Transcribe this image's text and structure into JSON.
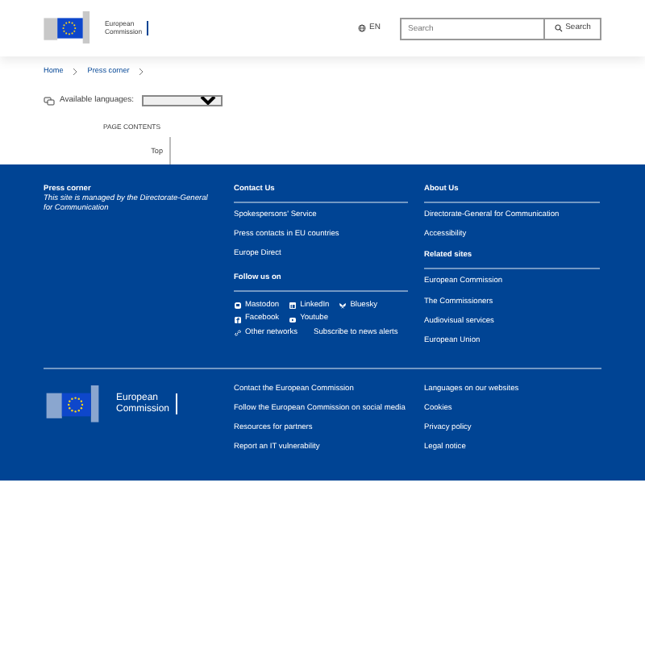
{
  "header": {
    "logo_lines": [
      "European",
      "Commission"
    ],
    "language": "EN",
    "search": {
      "placeholder": "Search"
    },
    "search_button": "Search"
  },
  "breadcrumb": [
    "Home",
    "Press corner"
  ],
  "languages": {
    "label": "Available languages:"
  },
  "page_contents": {
    "title": "PAGE CONTENTS",
    "items": [
      "Top"
    ]
  },
  "footer": {
    "site": {
      "title": "Press corner",
      "description": "This site is managed by the Directorate-General for Communication"
    },
    "contact": {
      "title": "Contact Us",
      "links": [
        "Spokespersons' Service",
        "Press contacts in EU countries",
        "Europe Direct"
      ]
    },
    "follow": {
      "title": "Follow us on",
      "rows": [
        [
          {
            "label": "Mastodon",
            "kind": "mastodon"
          },
          {
            "label": "LinkedIn",
            "kind": "linkedin"
          },
          {
            "label": "Bluesky",
            "kind": "bluesky"
          }
        ],
        [
          {
            "label": "Facebook",
            "kind": "facebook"
          },
          {
            "label": "Youtube",
            "kind": "youtube"
          }
        ],
        [
          {
            "label": "Other networks",
            "kind": "other"
          },
          {
            "label": "Subscribe to news alerts",
            "kind": "link"
          }
        ]
      ]
    },
    "about": {
      "title": "About Us",
      "links": [
        "Directorate-General for Communication",
        "Accessibility"
      ]
    },
    "related": {
      "title": "Related sites",
      "links": [
        "European Commission",
        "The Commissioners",
        "Audiovisual services",
        "European Union"
      ]
    },
    "logo_lines": [
      "European",
      "Commission"
    ],
    "bottom_links": [
      "Contact the European Commission",
      "Follow the European Commission on social media",
      "Resources for partners",
      "Report an IT vulnerability"
    ],
    "legal_links": [
      "Languages on our websites",
      "Cookies",
      "Privacy policy",
      "Legal notice"
    ]
  }
}
